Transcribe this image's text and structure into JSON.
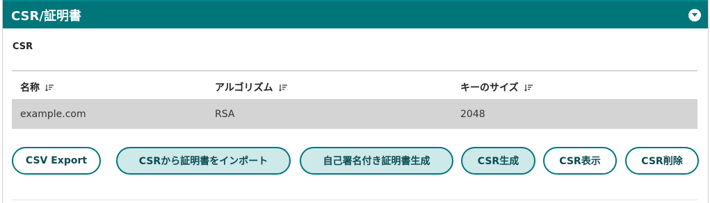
{
  "header": {
    "title": "CSR/証明書"
  },
  "section": {
    "title": "CSR"
  },
  "table": {
    "columns": [
      "名称",
      "アルゴリズム",
      "キーのサイズ"
    ],
    "rows": [
      [
        "example.com",
        "RSA",
        "2048"
      ]
    ]
  },
  "buttons": {
    "csv_export": "CSV Export",
    "import_cert": "CSRから証明書をインポート",
    "self_signed": "自己署名付き証明書生成",
    "generate_csr": "CSR生成",
    "show_csr": "CSR表示",
    "delete_csr": "CSR削除"
  },
  "colors": {
    "header_bg": "#00757a",
    "button_border": "#00757a",
    "button_filled_bg": "#cde9ea",
    "row_bg": "#d4d4d4"
  },
  "icons": [
    "chevron-down-icon",
    "sort-icon"
  ]
}
